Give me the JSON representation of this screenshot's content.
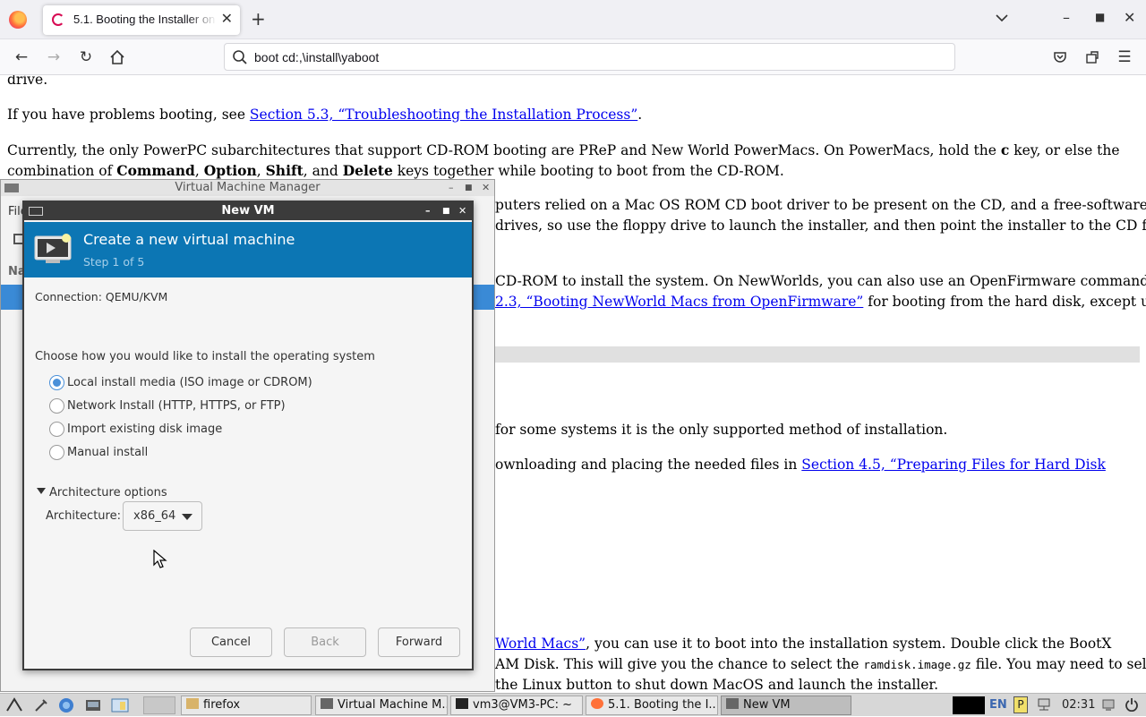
{
  "browser": {
    "tab_title": "5.1. Booting the Installer on",
    "url": "boot cd:,\\install\\yaboot",
    "icons": [
      "firefox-logo-icon",
      "back-icon",
      "forward-icon",
      "reload-icon",
      "home-icon",
      "pocket-icon",
      "extensions-icon",
      "menu-icon",
      "search-icon"
    ]
  },
  "page": {
    "line1": "drive.",
    "para2_prefix": "If you have problems booting, see ",
    "para2_link": "Section 5.3, “Troubleshooting the Installation Process”",
    "para2_suffix": ".",
    "para3_line1_a": "Currently, the only PowerPC subarchitectures that support CD-ROM booting are PReP and New World PowerMacs. On PowerMacs, hold the ",
    "para3_line1_key": "c",
    "para3_line1_b": " key, or else the",
    "para3_line2_a": "combination of ",
    "para3_line2_k1": "Command",
    "para3_line2_k2": "Option",
    "para3_line2_k3": "Shift",
    "para3_line2_and": ", and ",
    "para3_line2_k4": "Delete",
    "para3_line2_b": " keys together while booting to boot from the CD-ROM.",
    "para4_line1": "puters relied on a Mac OS ROM CD boot driver to be present on the CD, and a free-software",
    "para4_line2": " drives, so use the floppy drive to launch the installer, and then point the installer to the CD for",
    "para5_line1": "CD-ROM to install the system. On NewWorlds, you can also use an OpenFirmware command to",
    "para5_link": "2.3, “Booting NewWorld Macs from OpenFirmware”",
    "para5_line2_b": " for booting from the hard disk, except use",
    "para6": " for some systems it is the only supported method of installation.",
    "para7_a": "ownloading and placing the needed files in ",
    "para7_link": "Section 4.5, “Preparing Files for Hard Disk",
    "para8_link": "World Macs”",
    "para8_b": ", you can use it to boot into the installation system. Double click the BootX",
    "para9_a": "AM Disk. This will give you the chance to select the ",
    "para9_code": "ramdisk.image.gz",
    "para9_b": " file. You may need to select",
    "para10": "the Linux button to shut down MacOS and launch the installer."
  },
  "vmm": {
    "title": "Virtual Machine Manager",
    "menu_partial": "File",
    "name_partial": "Na"
  },
  "dialog": {
    "title": "New VM",
    "header_title": "Create a new virtual machine",
    "step": "Step 1 of 5",
    "connection": "Connection:  QEMU/KVM",
    "choose_label": "Choose how you would like to install the operating system",
    "options": [
      {
        "label": "Local install media (ISO image or CDROM)",
        "checked": true
      },
      {
        "label": "Network Install (HTTP, HTTPS, or FTP)",
        "checked": false
      },
      {
        "label": "Import existing disk image",
        "checked": false
      },
      {
        "label": "Manual install",
        "checked": false
      }
    ],
    "arch_expander": "Architecture options",
    "arch_label": "Architecture:",
    "arch_value": "x86_64",
    "cancel": "Cancel",
    "back": "Back",
    "forward": "Forward"
  },
  "taskbar": {
    "tasks": [
      "firefox",
      "Virtual Machine M...",
      "vm3@VM3-PC: ~",
      "5.1. Booting the I...",
      "New VM"
    ],
    "lang": "EN",
    "clock": "02:31"
  },
  "colors": {
    "header_blue": "#0c76b4",
    "link": "#0000ee",
    "radio_accent": "#4a90d9"
  }
}
